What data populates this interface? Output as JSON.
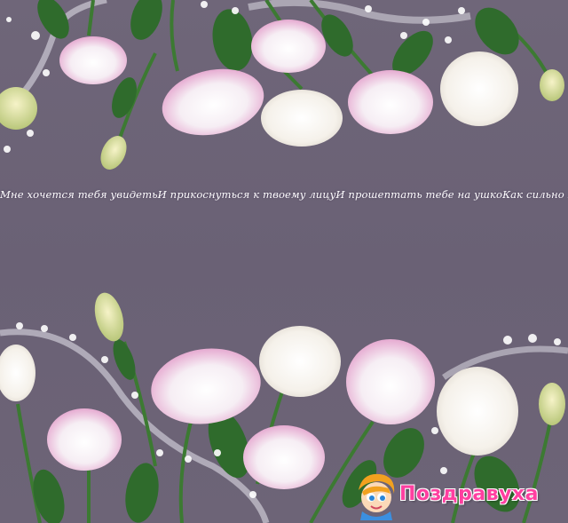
{
  "greeting": {
    "text": "Мне хочется тебя увидетьИ прикоснуться к твоему лицуИ прошептать тебе на ушкоКак сильно я тебя люблю!"
  },
  "logo": {
    "text": "Поздравуха"
  },
  "icons": {
    "mascot": "mascot-icon"
  },
  "colors": {
    "background": "#6e6478",
    "petal_white": "#f7f3ee",
    "petal_pink": "#e6a8cf",
    "leaf": "#2f6b2c",
    "logo_pink": "#ff3fa0"
  }
}
